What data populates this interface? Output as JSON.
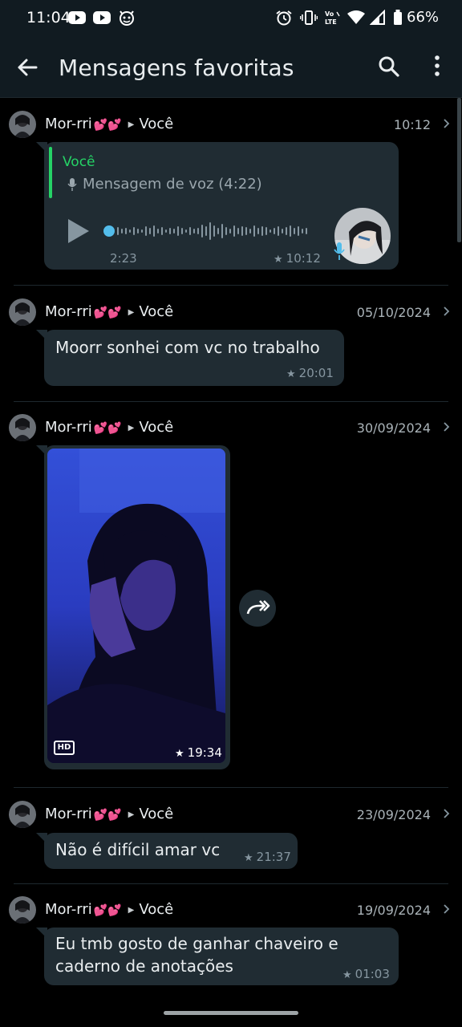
{
  "status_bar": {
    "time": "11:04",
    "battery": "66%"
  },
  "app_bar": {
    "title": "Mensagens favoritas"
  },
  "messages": [
    {
      "sender": "Mor-rri",
      "hearts": "💕💕",
      "recipient": "Você",
      "date": "10:12",
      "type": "voice",
      "quote_name": "Você",
      "quote_text": "Mensagem de voz (4:22)",
      "voice_position": "2:23",
      "time": "10:12"
    },
    {
      "sender": "Mor-rri",
      "hearts": "💕💕",
      "recipient": "Você",
      "date": "05/10/2024",
      "type": "text",
      "text": "Moorr sonhei com vc no trabalho",
      "time": "20:01"
    },
    {
      "sender": "Mor-rri",
      "hearts": "💕💕",
      "recipient": "Você",
      "date": "30/09/2024",
      "type": "video",
      "hd_label": "HD",
      "time": "19:34"
    },
    {
      "sender": "Mor-rri",
      "hearts": "💕💕",
      "recipient": "Você",
      "date": "23/09/2024",
      "type": "text",
      "text": "Não é difícil amar vc",
      "time": "21:37"
    },
    {
      "sender": "Mor-rri",
      "hearts": "💕💕",
      "recipient": "Você",
      "date": "19/09/2024",
      "type": "text",
      "text_lines": [
        "Eu tmb gosto de ganhar chaveiro e",
        "caderno de anotações"
      ],
      "time": "01:03"
    }
  ],
  "colors": {
    "app_bar_bg": "#111b21",
    "bubble_bg": "#202c33",
    "accent_green": "#25d366",
    "mic_blue": "#53bdeb"
  }
}
